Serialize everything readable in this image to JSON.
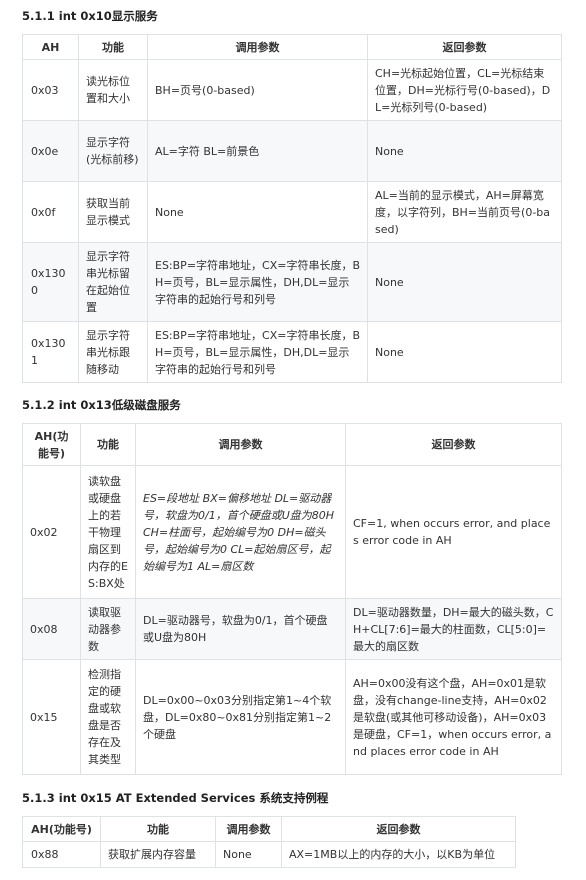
{
  "section1": {
    "title": "5.1.1 int 0x10显示服务",
    "headers": [
      "AH",
      "功能",
      "调用参数",
      "返回参数"
    ],
    "rows": [
      {
        "ah": "0x03",
        "func": "读光标位置和大小",
        "args": "BH=页号(0-based)",
        "ret": "CH=光标起始位置，CL=光标结束位置，DH=光标行号(0-based)，DL=光标列号(0-based)"
      },
      {
        "ah": "0x0e",
        "func": "显示字符(光标前移)",
        "args": "AL=字符 BL=前景色",
        "ret": "None"
      },
      {
        "ah": "0x0f",
        "func": "获取当前显示模式",
        "args": "None",
        "ret": "AL=当前的显示模式，AH=屏幕宽度，以字符列，BH=当前页号(0-based)"
      },
      {
        "ah": "0x1300",
        "func": "显示字符串光标留在起始位置",
        "args": "ES:BP=字符串地址，CX=字符串长度，BH=页号，BL=显示属性，DH,DL=显示字符串的起始行号和列号",
        "ret": "None"
      },
      {
        "ah": "0x1301",
        "func": "显示字符串光标跟随移动",
        "args": "ES:BP=字符串地址，CX=字符串长度，BH=页号，BL=显示属性，DH,DL=显示字符串的起始行号和列号",
        "ret": "None"
      }
    ]
  },
  "section2": {
    "title": "5.1.2 int 0x13低级磁盘服务",
    "headers": [
      "AH(功能号)",
      "功能",
      "调用参数",
      "返回参数"
    ],
    "rows": [
      {
        "ah": "0x02",
        "func": "读软盘或硬盘上的若干物理扇区到内存的ES:BX处",
        "args": "ES=段地址 BX=偏移地址 DL=驱动器号，软盘为0/1，首个硬盘或U盘为80H CH=柱面号，起始编号为0 DH=磁头号，起始编号为0 CL=起始扇区号，起始编号为1 AL=扇区数",
        "ret": "CF=1, when occurs error, and places error code in AH"
      },
      {
        "ah": "0x08",
        "func": "读取驱动器参数",
        "args": "DL=驱动器号，软盘为0/1，首个硬盘或U盘为80H",
        "ret": "DL=驱动器数量，DH=最大的磁头数，CH+CL[7:6]=最大的柱面数，CL[5:0]=最大的扇区数"
      },
      {
        "ah": "0x15",
        "func": "检测指定的硬盘或软盘是否存在及其类型",
        "args": "DL=0x00~0x03分别指定第1~4个软盘，DL=0x80~0x81分别指定第1~2个硬盘",
        "ret": "AH=0x00没有这个盘，AH=0x01是软盘，没有change-line支持，AH=0x02是软盘(或其他可移动设备)，AH=0x03是硬盘，CF=1，when occurs error, and places error code in AH"
      }
    ]
  },
  "section3": {
    "title": "5.1.3 int 0x15 AT Extended Services 系统支持例程",
    "headers": [
      "AH(功能号)",
      "功能",
      "调用参数",
      "返回参数"
    ],
    "rows": [
      {
        "ah": "0x88",
        "func": "获取扩展内存容量",
        "args": "None",
        "ret": "AX=1MB以上的内存的大小，以KB为单位"
      }
    ]
  }
}
